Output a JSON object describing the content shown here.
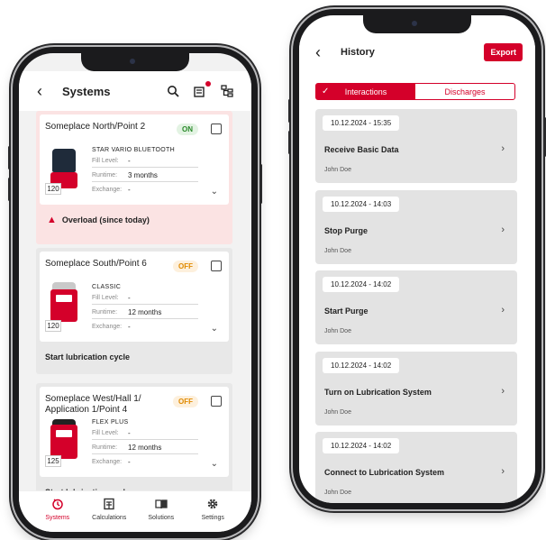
{
  "systems_screen": {
    "title": "Systems",
    "back_icon": "chevron-left-icon",
    "header_icons": [
      "search-icon",
      "bluetooth-list-icon",
      "tree-structure-icon"
    ],
    "items": [
      {
        "name": "Someplace North/Point 2",
        "status": "ON",
        "product": "STAR VARIO BLUETOOTH",
        "size": "120",
        "fill_level_label": "Fill Level:",
        "fill_level": "-",
        "runtime_label": "Runtime:",
        "runtime": "3 months",
        "exchange_label": "Exchange:",
        "exchange": "-",
        "alert": "Overload (since today)"
      },
      {
        "name": "Someplace South/Point 6",
        "status": "OFF",
        "product": "CLASSIC",
        "size": "120",
        "fill_level_label": "Fill Level:",
        "fill_level": "-",
        "runtime_label": "Runtime:",
        "runtime": "12 months",
        "exchange_label": "Exchange:",
        "exchange": "-",
        "action": "Start lubrication cycle"
      },
      {
        "name": "Someplace West/Hall 1/ Application 1/Point 4",
        "status": "OFF",
        "product": "FLEX PLUS",
        "size": "125",
        "fill_level_label": "Fill Level:",
        "fill_level": "-",
        "runtime_label": "Runtime:",
        "runtime": "12 months",
        "exchange_label": "Exchange:",
        "exchange": "-",
        "action": "Start lubrication cycle"
      }
    ],
    "tabs": [
      {
        "label": "Systems",
        "icon": "systems-icon",
        "active": true
      },
      {
        "label": "Calculations",
        "icon": "calculator-icon",
        "active": false
      },
      {
        "label": "Solutions",
        "icon": "book-icon",
        "active": false
      },
      {
        "label": "Settings",
        "icon": "gear-icon",
        "active": false
      }
    ]
  },
  "history_screen": {
    "title": "History",
    "export_label": "Export",
    "segments": {
      "interactions": "Interactions",
      "discharges": "Discharges"
    },
    "entries": [
      {
        "date": "10.12.2024 - 15:35",
        "action": "Receive Basic Data",
        "user": "John Doe"
      },
      {
        "date": "10.12.2024 - 14:03",
        "action": "Stop Purge",
        "user": "John Doe"
      },
      {
        "date": "10.12.2024 - 14:02",
        "action": "Start Purge",
        "user": "John Doe"
      },
      {
        "date": "10.12.2024 - 14:02",
        "action": "Turn on Lubrication System",
        "user": "John Doe"
      },
      {
        "date": "10.12.2024 - 14:02",
        "action": "Connect to Lubrication System",
        "user": "John Doe"
      }
    ]
  },
  "colors": {
    "accent": "#d4002a",
    "on": "#2a8a2a",
    "off": "#e08a00",
    "alert_bg": "#fbe3e3"
  }
}
